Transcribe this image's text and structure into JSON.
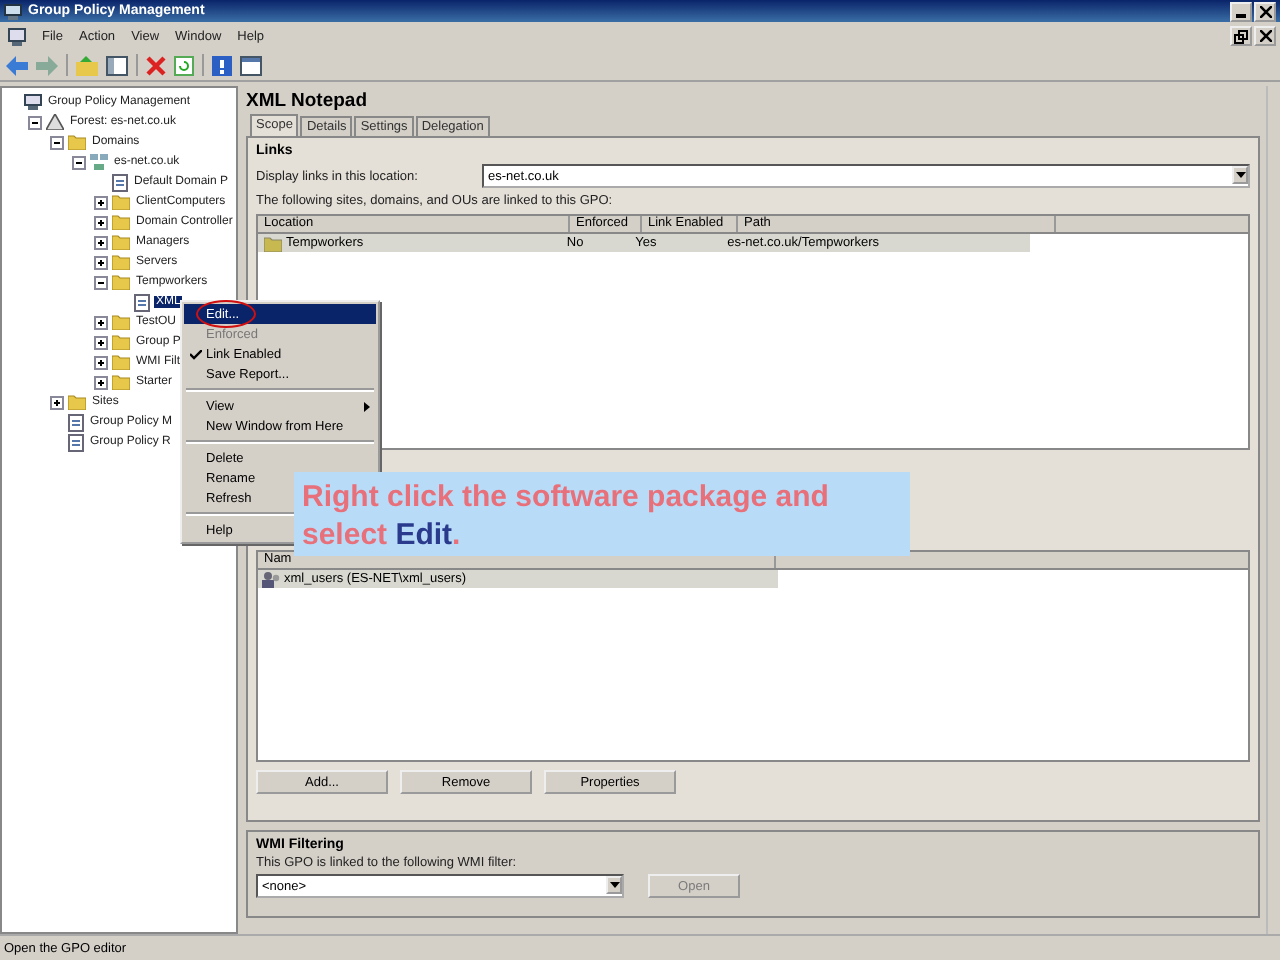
{
  "window": {
    "title": "Group Policy Management"
  },
  "menu_bar": [
    "File",
    "Action",
    "View",
    "Window",
    "Help"
  ],
  "tree": [
    {
      "label": "Group Policy Management",
      "kind": "console",
      "children": [
        {
          "label": "Forest: es-net.co.uk",
          "kind": "forest",
          "expanded": true,
          "children": [
            {
              "label": "Domains",
              "kind": "folder",
              "expanded": true,
              "children": [
                {
                  "label": "es-net.co.uk",
                  "kind": "domain",
                  "expanded": true,
                  "children": [
                    {
                      "label": "Default Domain P",
                      "kind": "gpo",
                      "selected": false
                    },
                    {
                      "label": "ClientComputers",
                      "kind": "folder",
                      "expanded": false
                    },
                    {
                      "label": "Domain Controller",
                      "kind": "folder",
                      "expanded": false
                    },
                    {
                      "label": "Managers",
                      "kind": "folder",
                      "expanded": false
                    },
                    {
                      "label": "Servers",
                      "kind": "folder",
                      "expanded": false
                    },
                    {
                      "label": "Tempworkers",
                      "kind": "folder",
                      "expanded": true,
                      "children": [
                        {
                          "label": "XML",
                          "kind": "gpo",
                          "selected": true
                        }
                      ]
                    },
                    {
                      "label": "TestOU",
                      "kind": "folder",
                      "expanded": false
                    },
                    {
                      "label": "Group P",
                      "kind": "folder",
                      "expanded": false
                    },
                    {
                      "label": "WMI Filt",
                      "kind": "folder",
                      "expanded": false
                    },
                    {
                      "label": "Starter",
                      "kind": "folder",
                      "expanded": false
                    }
                  ]
                }
              ]
            },
            {
              "label": "Sites",
              "kind": "folder",
              "expanded": false
            },
            {
              "label": "Group Policy M",
              "kind": "gpo",
              "selected": false
            },
            {
              "label": "Group Policy R",
              "kind": "gpo",
              "selected": false
            }
          ]
        }
      ]
    }
  ],
  "details": {
    "title": "XML Notepad",
    "tabs": [
      {
        "label": "Scope",
        "selected": true
      },
      {
        "label": "Details",
        "selected": false
      },
      {
        "label": "Settings",
        "selected": false
      },
      {
        "label": "Delegation",
        "selected": false
      }
    ],
    "links_heading": "Links",
    "display_label": "Display links in this location:",
    "location": "es-net.co.uk",
    "description": "The following sites, domains, and OUs are linked to this GPO:",
    "links_table": {
      "columns": [
        "Location",
        "Enforced",
        "Link Enabled",
        "Path"
      ],
      "rows": [
        [
          "Tempworkers",
          "No",
          "Yes",
          "es-net.co.uk/Tempworkers"
        ]
      ]
    },
    "security_table": {
      "columns": [
        "Nam"
      ],
      "rows": [
        "xml_users (ES-NET\\xml_users)"
      ]
    },
    "buttons": [
      {
        "label": "Add...",
        "disabled": false
      },
      {
        "label": "Remove",
        "disabled": false
      },
      {
        "label": "Properties",
        "disabled": false
      }
    ],
    "wmi": {
      "heading": "WMI Filtering",
      "text": "This GPO is linked to the following WMI filter:",
      "value": "<none>",
      "button": {
        "label": "Open",
        "disabled": true
      }
    }
  },
  "context_menu": [
    {
      "kind": "item",
      "label": "Edit...",
      "selected": true,
      "checked": false,
      "disabled": false
    },
    {
      "kind": "item",
      "label": "Enforced",
      "selected": false,
      "checked": false,
      "disabled": true
    },
    {
      "kind": "item",
      "label": "Link Enabled",
      "selected": false,
      "checked": true,
      "disabled": false
    },
    {
      "kind": "item",
      "label": "Save Report...",
      "selected": false,
      "checked": false,
      "disabled": false
    },
    {
      "kind": "separator"
    },
    {
      "kind": "submenu",
      "label": "View",
      "selected": false,
      "checked": false,
      "disabled": false
    },
    {
      "kind": "item",
      "label": "New Window from Here",
      "selected": false,
      "checked": false,
      "disabled": false
    },
    {
      "kind": "separator"
    },
    {
      "kind": "item",
      "label": "Delete",
      "selected": false,
      "checked": false,
      "disabled": false
    },
    {
      "kind": "item",
      "label": "Rename",
      "selected": false,
      "checked": false,
      "disabled": false
    },
    {
      "kind": "item",
      "label": "Refresh",
      "selected": false,
      "checked": false,
      "disabled": false
    },
    {
      "kind": "separator"
    },
    {
      "kind": "item",
      "label": "Help",
      "selected": false,
      "checked": false,
      "disabled": false
    }
  ],
  "callout": {
    "text": "Right click the software package and select **Edit**."
  },
  "status_bar": {
    "text": "Open the GPO editor"
  }
}
